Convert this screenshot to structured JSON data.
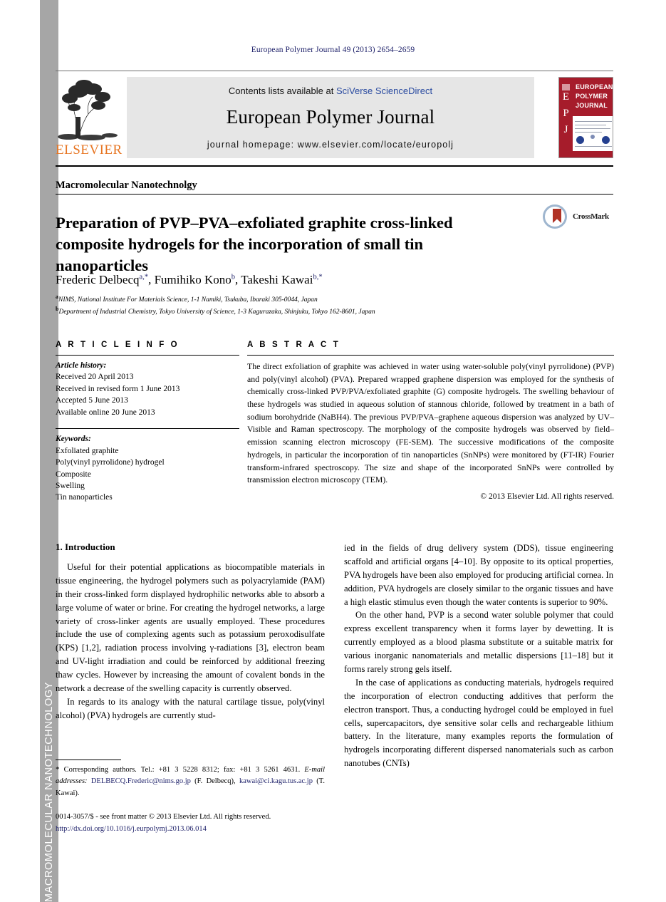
{
  "running_head": "European Polymer Journal 49 (2013) 2654–2659",
  "sidebar": {
    "label": "MACROMOLECULAR NANOTECHNOLOGY",
    "bg_color": "#a6a6a6",
    "text_color": "#ffffff"
  },
  "masthead": {
    "contents_prefix": "Contents lists available at ",
    "contents_link": "SciVerse ScienceDirect",
    "journal_title": "European Polymer Journal",
    "homepage": "journal homepage: www.elsevier.com/locate/europolj",
    "publisher_wordmark": "ELSEVIER",
    "publisher_wordmark_color": "#e77522",
    "cover": {
      "spine_letters": [
        "E",
        "P",
        "J"
      ],
      "band_lines": [
        "EUROPEAN",
        "POLYMER",
        "JOURNAL"
      ],
      "accent_color": "#a61c2b"
    }
  },
  "section_label": "Macromolecular Nanotechnolgy",
  "title": "Preparation of PVP–PVA–exfoliated graphite cross-linked composite hydrogels for the incorporation of small tin nanoparticles",
  "crossmark": {
    "label": "CrossMark"
  },
  "authors": [
    {
      "name": "Frederic Delbecq",
      "marks": "a,*"
    },
    {
      "name": "Fumihiko Kono",
      "marks": "b"
    },
    {
      "name": "Takeshi Kawai",
      "marks": "b,*"
    }
  ],
  "affiliations": [
    {
      "mark": "a",
      "text": "NIMS, National Institute For Materials Science, 1-1 Namiki, Tsukuba, Ibaraki 305-0044, Japan"
    },
    {
      "mark": "b",
      "text": "Department of Industrial Chemistry, Tokyo University of Science, 1-3 Kagurazaka, Shinjuku, Tokyo 162-8601, Japan"
    }
  ],
  "article_info": {
    "heading": "A R T I C L E  I N F O",
    "history_title": "Article history:",
    "history": [
      "Received 20 April 2013",
      "Received in revised form 1 June 2013",
      "Accepted 5 June 2013",
      "Available online 20 June 2013"
    ],
    "keywords_title": "Keywords:",
    "keywords": [
      "Exfoliated graphite",
      "Poly(vinyl pyrrolidone) hydrogel",
      "Composite",
      "Swelling",
      "Tin nanoparticles"
    ]
  },
  "abstract": {
    "heading": "A B S T R A C T",
    "text": "The direct exfoliation of graphite was achieved in water using water-soluble poly(vinyl pyrrolidone) (PVP) and poly(vinyl alcohol) (PVA). Prepared wrapped graphene dispersion was employed for the synthesis of chemically cross-linked PVP/PVA/exfoliated graphite (G) composite hydrogels. The swelling behaviour of these hydrogels was studied in aqueous solution of stannous chloride, followed by treatment in a bath of sodium borohydride (NaBH4). The previous PVP/PVA–graphene aqueous dispersion was analyzed by UV–Visible and Raman spectroscopy. The morphology of the composite hydrogels was observed by field–emission scanning electron microscopy (FE-SEM). The successive modifications of the composite hydrogels, in particular the incorporation of tin nanoparticles (SnNPs) were monitored by (FT-IR) Fourier transform-infrared spectroscopy. The size and shape of the incorporated SnNPs were controlled by transmission electron microscopy (TEM).",
    "copyright": "© 2013 Elsevier Ltd. All rights reserved."
  },
  "body": {
    "section_number_title": "1. Introduction",
    "left_paragraphs": [
      "Useful for their potential applications as biocompatible materials in tissue engineering, the hydrogel polymers such as polyacrylamide (PAM) in their cross-linked form displayed hydrophilic networks able to absorb a large volume of water or brine. For creating the hydrogel networks, a large variety of cross-linker agents are usually employed. These procedures include the use of complexing agents such as potassium peroxodisulfate (KPS) [1,2], radiation process involving γ-radiations [3], electron beam and UV-light irradiation and could be reinforced by additional freezing thaw cycles. However by increasing the amount of covalent bonds in the network a decrease of the swelling capacity is currently observed.",
      "In regards to its analogy with the natural cartilage tissue, poly(vinyl alcohol) (PVA) hydrogels are currently stud-"
    ],
    "right_paragraphs": [
      "ied in the fields of drug delivery system (DDS), tissue engineering scaffold and artificial organs [4–10]. By opposite to its optical properties, PVA hydrogels have been also employed for producing artificial cornea. In addition, PVA hydrogels are closely similar to the organic tissues and have a high elastic stimulus even though the water contents is superior to 90%.",
      "On the other hand, PVP is a second water soluble polymer that could express excellent transparency when it forms layer by dewetting. It is currently employed as a blood plasma substitute or a suitable matrix for various inorganic nanomaterials and metallic dispersions [11–18] but it forms rarely strong gels itself.",
      "In the case of applications as conducting materials, hydrogels required the incorporation of electron conducting additives that perform the electron transport. Thus, a conducting hydrogel could be employed in fuel cells, supercapacitors, dye sensitive solar cells and rechargeable lithium battery. In the literature, many examples reports the formulation of hydrogels incorporating different dispersed nanomaterials such as carbon nanotubes (CNTs)"
    ]
  },
  "footnote": {
    "star": "*",
    "corresponding": "Corresponding authors. Tel.: +81 3 5228 8312; fax: +81 3 5261 4631.",
    "email_label": "E-mail addresses:",
    "email_1": "DELBECQ.Frederic@nims.go.jp",
    "email_1_owner": "(F. Delbecq)",
    "email_2": "kawai@ci.kagu.tus.ac.jp",
    "email_2_owner": "(T. Kawai)."
  },
  "imprint": {
    "line1": "0014-3057/$ - see front matter © 2013 Elsevier Ltd. All rights reserved.",
    "doi": "http://dx.doi.org/10.1016/j.eurpolymj.2013.06.014"
  },
  "colors": {
    "link": "#20236b",
    "sciencedirect_link": "#2a4ba0",
    "elsevier_orange": "#e77522",
    "cover_red": "#a61c2b",
    "sidebar_gray": "#a6a6a6"
  }
}
